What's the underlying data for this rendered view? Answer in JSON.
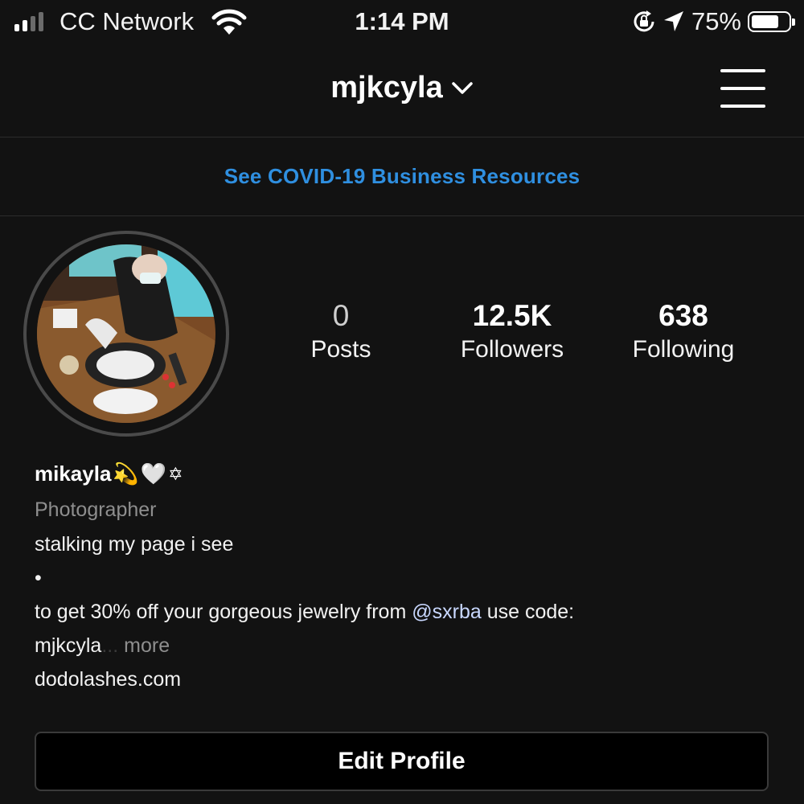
{
  "status_bar": {
    "carrier": "CC Network",
    "time": "1:14 PM",
    "battery_percent": "75%",
    "battery_level": 0.75,
    "signal_bars": 2,
    "icons": [
      "signal-icon",
      "wifi-icon",
      "rotation-lock-icon",
      "location-arrow-icon",
      "battery-icon"
    ]
  },
  "header": {
    "username": "mjkcyla",
    "icons": [
      "chevron-down-icon",
      "menu-icon"
    ]
  },
  "banner": {
    "text": "See COVID-19 Business Resources",
    "color": "#2f8fe0"
  },
  "stats": [
    {
      "value": "0",
      "label": "Posts"
    },
    {
      "value": "12.5K",
      "label": "Followers"
    },
    {
      "value": "638",
      "label": "Following"
    }
  ],
  "bio": {
    "display_name": "mikayla",
    "name_emojis": [
      "💫",
      "🤍",
      "✡"
    ],
    "category": "Photographer",
    "line1": "stalking my page i see",
    "line2": "•",
    "line3_prefix": "to get 30% off your gorgeous jewelry from ",
    "line3_mention": "@sxrba",
    "line3_suffix": " use code:",
    "line4": "mjkcyla",
    "line4_ellipsis": "...",
    "more": "more",
    "website": "dodolashes.com"
  },
  "edit_profile_button": "Edit Profile",
  "colors": {
    "background": "#121212",
    "link": "#c9d8ff",
    "secondary_text": "#8e8e8e"
  }
}
